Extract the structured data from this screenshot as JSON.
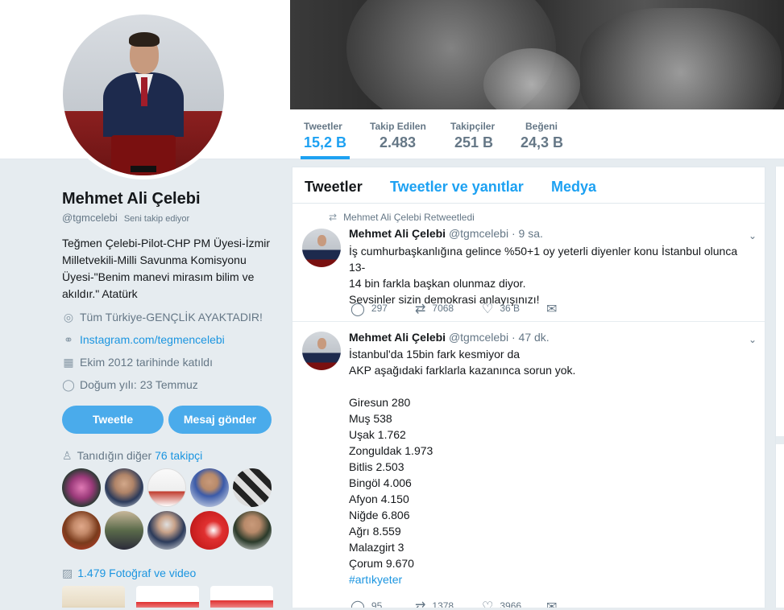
{
  "colors": {
    "accent": "#1da1f2",
    "link": "#1b95e0",
    "button": "#4aabeb",
    "muted": "#657786"
  },
  "nav": {
    "stats": [
      {
        "label": "Tweetler",
        "value": "15,2 B",
        "active": true
      },
      {
        "label": "Takip Edilen",
        "value": "2.483"
      },
      {
        "label": "Takipçiler",
        "value": "251 B"
      },
      {
        "label": "Beğeni",
        "value": "24,3 B"
      }
    ]
  },
  "profile": {
    "name": "Mehmet Ali Çelebi",
    "handle": "@tgmcelebi",
    "follows_you": "Seni takip ediyor",
    "bio": "Teğmen Çelebi-Pilot-CHP PM Üyesi-İzmir Milletvekili-Milli Savunma Komisyonu Üyesi-\"Benim manevi mirasım bilim ve akıldır.\" Atatürk",
    "location": "Tüm Türkiye-GENÇLİK AYAKTADIR!",
    "website": "Instagram.com/tegmencelebi",
    "joined": "Ekim 2012 tarihinde katıldı",
    "birthday": "Doğum yılı: 23 Temmuz",
    "tweet_button": "Tweetle",
    "message_button": "Mesaj gönder",
    "followers_known_prefix": "Tanıdığın diğer",
    "followers_known_link": "76 takipçi",
    "photos_label": "1.479 Fotoğraf ve video"
  },
  "icons": {
    "location": "location-icon",
    "link": "link-icon",
    "calendar": "calendar-icon",
    "birthday": "balloon-icon",
    "person": "person-icon",
    "photo": "photo-icon",
    "retweet": "retweet-icon",
    "reply": "reply-icon",
    "like": "heart-icon",
    "dm": "envelope-icon",
    "caret": "chevron-down-icon"
  },
  "timeline": {
    "tabs": [
      "Tweetler",
      "Tweetler ve yanıtlar",
      "Medya"
    ],
    "tweets": [
      {
        "retweeted_by": "Mehmet Ali Çelebi Retweetledi",
        "name": "Mehmet Ali Çelebi",
        "handle": "@tgmcelebi",
        "time": "· 9 sa.",
        "lines": [
          "İş cumhurbaşkanlığına gelince %50+1 oy yeterli diyenler konu İstanbul olunca 13-",
          "14 bin farkla başkan olunmaz diyor.",
          "Sevsinler sizin demokrasi anlayışınızı!"
        ],
        "replies": "297",
        "retweets": "7068",
        "likes": "36 B"
      },
      {
        "name": "Mehmet Ali Çelebi",
        "handle": "@tgmcelebi",
        "time": "· 47 dk.",
        "lines": [
          "İstanbul'da 15bin fark kesmiyor da",
          "AKP aşağıdaki farklarla kazanınca sorun yok.",
          "",
          "Giresun 280",
          "Muş 538",
          "Uşak 1.762",
          "Zonguldak 1.973",
          "Bitlis 2.503",
          "Bingöl 4.006",
          "Afyon 4.150",
          "Niğde 6.806",
          "Ağrı 8.559",
          "Malazgirt 3",
          "Çorum 9.670"
        ],
        "hashtag": "#artıkyeter",
        "replies": "95",
        "retweets": "1378",
        "likes": "3966"
      }
    ]
  }
}
